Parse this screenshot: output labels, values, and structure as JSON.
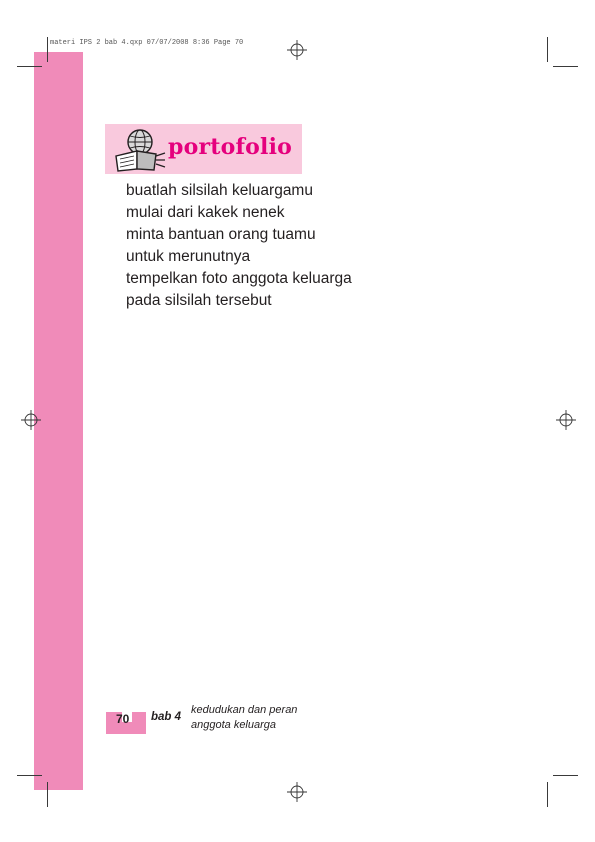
{
  "slug": {
    "text": "materi IPS 2 bab 4.qxp  07/07/2008  8:36  Page 70"
  },
  "section_banner": {
    "title": "portofolio",
    "icon": "book-globe-icon"
  },
  "body_lines": [
    "buatlah silsilah keluargamu",
    "mulai dari kakek nenek",
    "minta bantuan orang tuamu",
    "untuk merunutnya",
    "tempelkan foto anggota keluarga",
    "pada silsilah tersebut"
  ],
  "footer": {
    "page_number": "70",
    "chapter": "bab 4",
    "chapter_title_lines": [
      "kedudukan dan peran",
      "anggota keluarga"
    ]
  },
  "colors": {
    "pink_bar": "#f08bb9",
    "banner_bg": "#f9c9dd",
    "title_magenta": "#e5007d",
    "text": "#231f20"
  }
}
